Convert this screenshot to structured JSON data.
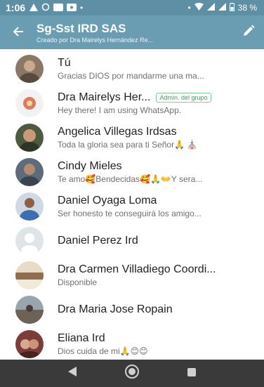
{
  "status_bar": {
    "time": "1:06",
    "battery": "38 %"
  },
  "app_bar": {
    "title": "Sg-Sst IRD SAS",
    "subtitle": "Creado por Dra Mairelys Hernández Re..."
  },
  "participants": [
    {
      "name": "Tú",
      "status": "Gracias DIOS por mandarme una ma...",
      "avatar_color": "#8a7766"
    },
    {
      "name": "Dra Mairelys Her...",
      "status": "Hey there! I am using WhatsApp.",
      "badge": "Admin. del grupo",
      "avatar_color": "#e07a5f"
    },
    {
      "name": "Angelica Villegas Irdsas",
      "status": "Toda la gloria sea para ti Señor🙏 ⛪",
      "avatar_color": "#4e5a3e"
    },
    {
      "name": "Cindy Mieles",
      "status": "Te amo🥰Bendecidas🥰🙏👐Y sera...",
      "avatar_color": "#5d6b7a"
    },
    {
      "name": "Daniel Oyaga Loma",
      "status": "Ser honesto te conseguirá los amigo...",
      "avatar_color": "#3b6fb0"
    },
    {
      "name": "Daniel Perez Ird",
      "status": "",
      "avatar_color": "#dfe5e7"
    },
    {
      "name": "Dra Carmen Villadiego Coordi...",
      "status": "Disponible",
      "avatar_color": "#8e6e4e"
    },
    {
      "name": "Dra Maria Jose Ropain",
      "status": "",
      "avatar_color": "#6e6256"
    },
    {
      "name": "Eliana Ird",
      "status": "Dios cuida de mi🙏😊😊",
      "avatar_color": "#7a3d3a"
    }
  ],
  "colors": {
    "status_bar": "#5f8fa4",
    "app_bar": "#6a9db1",
    "admin_badge": "#3aa65a",
    "nav_bar": "#3a3a3a"
  },
  "icons": {
    "back": "arrow-left-icon",
    "edit": "pencil-icon",
    "nav": [
      "back-triangle-icon",
      "home-circle-icon",
      "recents-square-icon"
    ]
  }
}
